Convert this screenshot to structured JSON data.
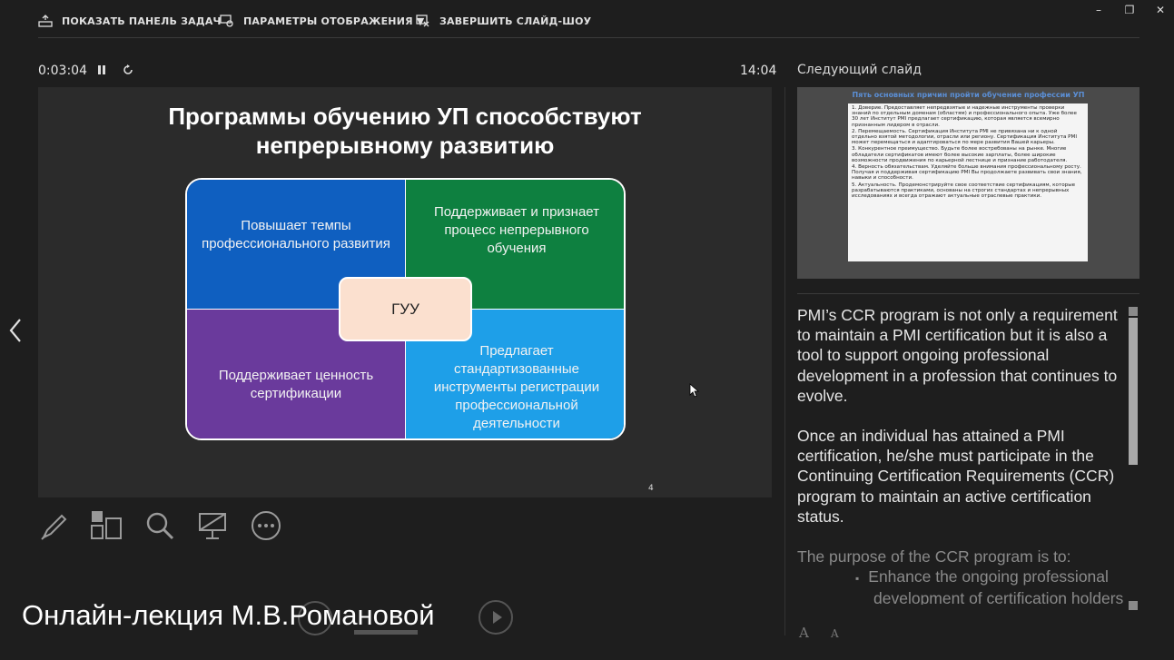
{
  "toolbar": {
    "show_taskbar": "ПОКАЗАТЬ ПАНЕЛЬ ЗАДАЧ",
    "display_settings": "ПАРАМЕТРЫ ОТОБРАЖЕНИЯ ▼",
    "end_show": "ЗАВЕРШИТЬ СЛАЙД-ШОУ"
  },
  "timer": {
    "elapsed": "0:03:04",
    "clock": "14:04"
  },
  "slide": {
    "title_line1": "Программы обучению УП способствуют",
    "title_line2": "непрерывному развитию",
    "quadrants": {
      "top_left": "Повышает темпы профессионального развития",
      "top_right": "Поддерживает и признает процесс непрерывного обучения",
      "bottom_left": "Поддерживает ценность сертификации",
      "bottom_right": "Предлагает стандартизованные инструменты регистрации профессиональной деятельности"
    },
    "center": "ГУУ",
    "page_number": "4",
    "colors": {
      "top_left": "#0f5fc0",
      "top_right": "#0e8040",
      "bottom_left": "#6a3a9c",
      "bottom_right": "#1e9fe8",
      "center": "#fbe0cf"
    }
  },
  "next_slide": {
    "label": "Следующий слайд",
    "title": "Пять основных причин пройти обучение профессии УП",
    "items": [
      "1. Доверие. Предоставляет непредвзятые и надежные инструменты проверки знаний по отдельным доменам (областям) и профессионального опыта. Уже более 30 лет Институт PMI предлагает сертификацию, которая является всемирно признанным лидером в отрасли.",
      "2. Перемещаемость. Сертификация Института PMI не привязана ни к одной отдельно взятой методологии, отрасли или региону. Сертификация Института PMI может перемещаться и адаптироваться по мере развития Вашей карьеры.",
      "3. Конкурентное преимущество. Будьте более востребованы на рынке. Многие обладатели сертификатов имеют более высокие зарплаты, более широкие возможности продвижения по карьерной лестнице и признание работодателя.",
      "4. Верность обязательствам. Уделяйте больше внимания профессиональному росту. Получая и поддерживая сертификацию PMI Вы продолжаете развивать свои знания, навыки и способности.",
      "5. Актуальность. Продемонстрируйте свое соответствие сертификациям, которые разрабатываются практиками, основаны на строгих стандартах и непрерывных исследованиях и всегда отражают актуальные отраслевые практики."
    ]
  },
  "notes": {
    "para1": "PMI’s CCR program is not only a requirement to maintain a PMI certification but it is also a tool to support ongoing professional development in a profession that continues to evolve.",
    "para2": "Once an individual has attained a PMI certification, he/she must participate in the Continuing Certification Requirements (CCR) program to maintain an active certification status.",
    "para3": "The purpose of the CCR program is to:",
    "bullet1": "Enhance the ongoing professional development of certification holders"
  },
  "font_controls": {
    "increase": "A",
    "decrease": "A"
  },
  "overlay_caption": "Онлайн-лекция М.В.Романовой"
}
